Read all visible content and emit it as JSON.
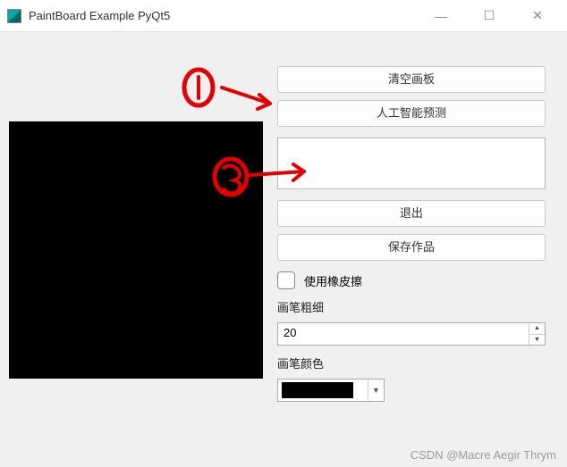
{
  "window": {
    "title": "PaintBoard Example PyQt5"
  },
  "buttons": {
    "clear": "清空画板",
    "predict": "人工智能预测",
    "quit": "退出",
    "save": "保存作品"
  },
  "checkbox": {
    "eraser_label": "使用橡皮擦",
    "checked": false
  },
  "labels": {
    "thickness": "画笔粗细",
    "color": "画笔颜色"
  },
  "thickness": {
    "value": "20"
  },
  "color": {
    "value": "#000000"
  },
  "output": {
    "value": ""
  },
  "annotations": {
    "mark1": "1",
    "mark2": "2"
  },
  "watermark": "CSDN @Macre Aegir Thrym"
}
